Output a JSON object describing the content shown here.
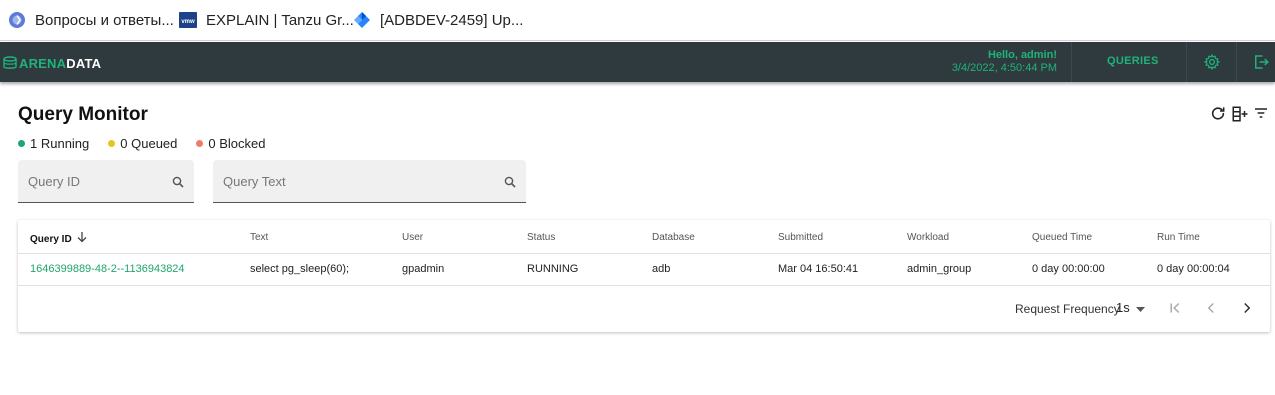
{
  "bookmarks": [
    {
      "label": "Вопросы и ответы...",
      "icon": "qa-globe-icon"
    },
    {
      "label": "EXPLAIN | Tanzu Gr...",
      "icon": "vmware-icon"
    },
    {
      "label": "[ADBDEV-2459] Up...",
      "icon": "jira-icon"
    }
  ],
  "header": {
    "logo_part1": "ARENA",
    "logo_part2": "DATA",
    "greeting": "Hello, admin!",
    "datetime": "3/4/2022, 4:50:44 PM",
    "nav_queries": "QUERIES"
  },
  "page": {
    "title": "Query Monitor",
    "statuses": [
      {
        "label": "1 Running",
        "color": "#1fa56f"
      },
      {
        "label": "0 Queued",
        "color": "#e8c51a"
      },
      {
        "label": "0 Blocked",
        "color": "#ef7b6d"
      }
    ],
    "filters": {
      "query_id_placeholder": "Query ID",
      "query_text_placeholder": "Query Text"
    }
  },
  "table": {
    "columns": [
      "Query ID",
      "Text",
      "User",
      "Status",
      "Database",
      "Submitted",
      "Workload",
      "Queued Time",
      "Run Time"
    ],
    "rows": [
      [
        "1646399889-48-2--1136943824",
        "select pg_sleep(60);",
        "gpadmin",
        "RUNNING",
        "adb",
        "Mar 04 16:50:41",
        "admin_group",
        "0 day 00:00:00",
        "0 day 00:00:04"
      ]
    ]
  },
  "footer": {
    "request_frequency_label": "Request Frequency",
    "request_frequency_value": "1s"
  },
  "colors": {
    "accent": "#1fb37a",
    "appbar": "#2f3a3e"
  }
}
